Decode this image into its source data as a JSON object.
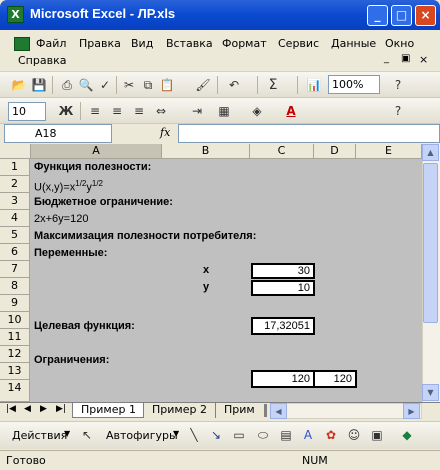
{
  "window": {
    "title": "Microsoft Excel - ЛР.xls",
    "app_icon": "X"
  },
  "menu": [
    "Файл",
    "Правка",
    "Вид",
    "Вставка",
    "Формат",
    "Сервис",
    "Данные",
    "Окно"
  ],
  "menu2": "Справка",
  "toolbar": {
    "zoom": "100%",
    "font_size": "10",
    "bold": "Ж"
  },
  "formula_bar": {
    "name_box": "A18",
    "fx": "fx"
  },
  "columns": [
    "A",
    "B",
    "C",
    "D",
    "E"
  ],
  "rows": [
    "1",
    "2",
    "3",
    "4",
    "5",
    "6",
    "7",
    "8",
    "9",
    "10",
    "11",
    "12",
    "13",
    "14"
  ],
  "cells": {
    "r1": "Функция полезности:",
    "r2_main": "U(x,y)=x",
    "r2_sup1": "1/2",
    "r2_y": "y",
    "r2_sup2": "1/2",
    "r3": "Бюджетное ограничение:",
    "r4": "2x+6y=120",
    "r5": "Максимизация полезности потребителя:",
    "r6": "Переменные:",
    "r7_label": "x",
    "r7_value": "30",
    "r8_label": "y",
    "r8_value": "10",
    "r10_label": "Целевая функция:",
    "r10_value": "17,32051",
    "r12": "Ограничения:",
    "r13_c": "120",
    "r13_d": "120"
  },
  "sheet_tabs": [
    "Пример 1",
    "Пример 2",
    "Прим"
  ],
  "drawing": {
    "actions": "Действия",
    "autoshapes": "Автофигуры"
  },
  "status": {
    "left": "Готово",
    "num": "NUM"
  }
}
